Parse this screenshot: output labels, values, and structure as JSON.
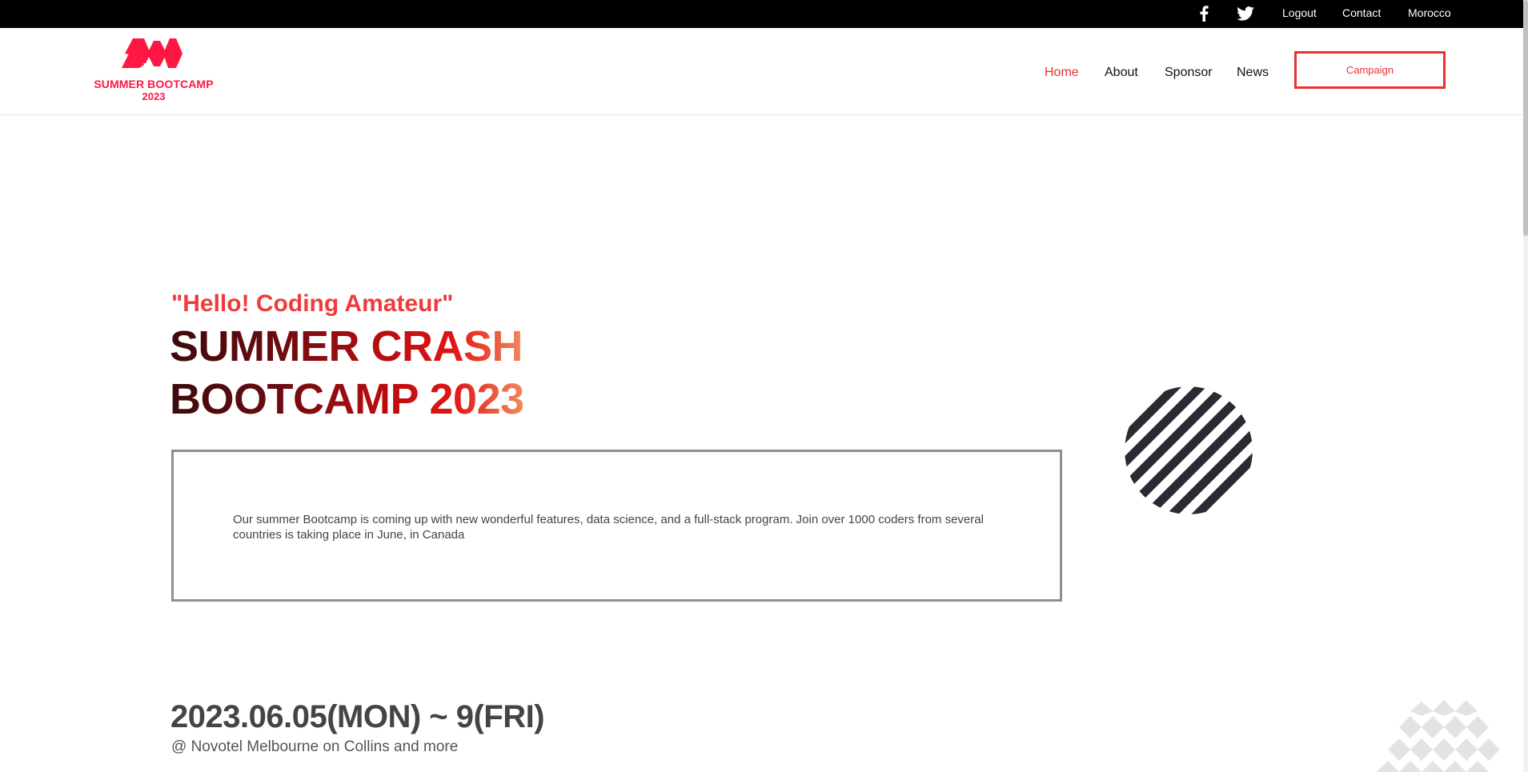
{
  "topbar": {
    "social": [
      {
        "icon": "facebook-icon"
      },
      {
        "icon": "twitter-icon"
      }
    ],
    "links": [
      "Logout",
      "Contact",
      "Morocco"
    ]
  },
  "logo": {
    "line1": "SUMMER BOOTCAMP",
    "line2": "2023",
    "color": "#ff1744"
  },
  "nav": {
    "items": [
      "Home",
      "About",
      "Sponsor",
      "News"
    ],
    "active": "Home",
    "cta": "Campaign",
    "accent": "#e8322f"
  },
  "hero": {
    "tagline": "\"Hello! Coding Amateur\"",
    "title_line1": "SUMMER CRASH",
    "title_line2": "BOOTCAMP 2023",
    "description": "Our summer Bootcamp is coming up with new wonderful features, data science, and a full-stack program. Join over 1000 coders from several countries is taking place in June, in Canada"
  },
  "event": {
    "date": "2023.06.05(MON) ~ 9(FRI)",
    "venue": "@ Novotel Melbourne on Collins and more"
  }
}
